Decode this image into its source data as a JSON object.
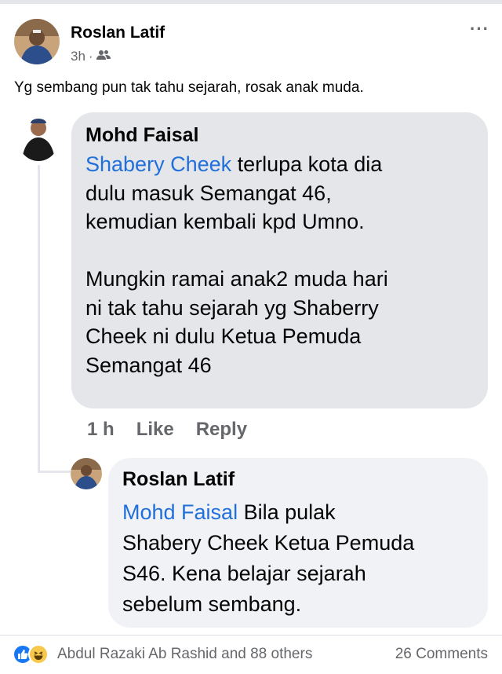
{
  "post": {
    "author": "Roslan Latif",
    "time": "3h",
    "separator": "·",
    "audience_icon": "friends-icon",
    "more_label": "···",
    "text": "Yg sembang pun tak tahu sejarah, rosak anak muda."
  },
  "comment": {
    "author": "Mohd Faisal",
    "mention": "Shabery Cheek",
    "body": " terlupa kota dia\ndulu masuk Semangat 46,\nkemudian kembali kpd Umno.\n\nMungkin ramai anak2 muda hari\nni tak tahu sejarah yg Shaberry\nCheek ni dulu Ketua Pemuda\nSemangat 46",
    "time": "1 h",
    "like_label": "Like",
    "reply_label": "Reply"
  },
  "reply": {
    "author": "Roslan Latif",
    "mention": "Mohd Faisal",
    "body": " Bila pulak\nShabery Cheek Ketua Pemuda\nS46. Kena belajar sejarah\nsebelum sembang."
  },
  "footer": {
    "reactors": "Abdul Razaki Ab Rashid and 88 others",
    "comments": "26 Comments",
    "reaction_icons": [
      "like-icon",
      "haha-icon"
    ]
  },
  "colors": {
    "mention": "#216fdb",
    "comment_bubble": "#e4e6ea",
    "reply_bubble": "#f0f2f5",
    "secondary_text": "#65676b",
    "like_blue": "#1877f2",
    "haha_yellow": "#f7c84b"
  }
}
